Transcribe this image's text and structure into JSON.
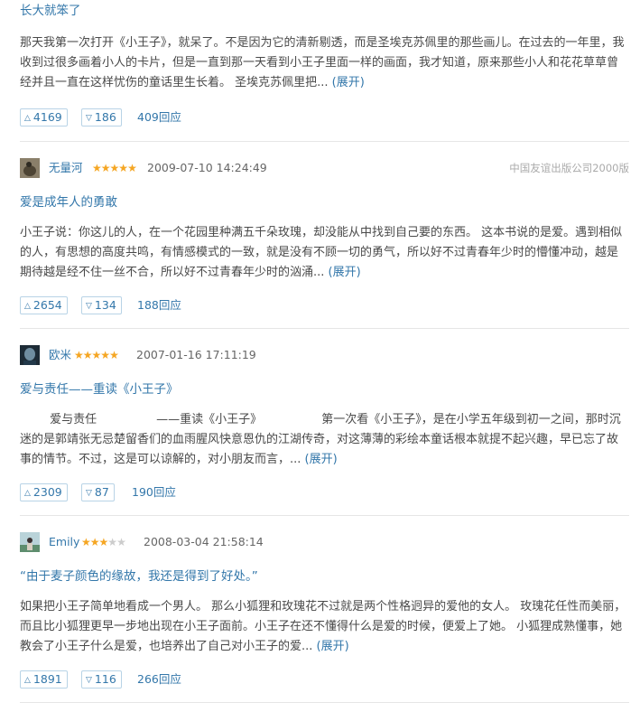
{
  "reviews": [
    {
      "title": "长大就笨了",
      "body": "那天我第一次打开《小王子》，就呆了。不是因为它的清新剔透，而是圣埃克苏佩里的那些画儿。在过去的一年里，我收到过很多画着小人的卡片，但是一直到那一天看到小王子里面一样的画面，我才知道，原来那些小人和花花草草曾经并且一直在这样忧伤的童话里生长着。 圣埃克苏佩里把... ",
      "expand": "(展开)",
      "useful": "4169",
      "useless": "186",
      "replies": "409回应"
    },
    {
      "author": "无量河",
      "rating": 5,
      "time": "2009-07-10 14:24:49",
      "source": "中国友谊出版公司2000版",
      "title": "爱是成年人的勇敢",
      "body": "小王子说：你这儿的人，在一个花园里种满五千朵玫瑰，却没能从中找到自己要的东西。 这本书说的是爱。遇到相似的人，有思想的高度共鸣，有情感模式的一致，就是没有不顾一切的勇气，所以好不过青春年少时的懵懂冲动，越是期待越是经不住一丝不合，所以好不过青春年少时的汹涌... ",
      "expand": "(展开)",
      "useful": "2654",
      "useless": "134",
      "replies": "188回应"
    },
    {
      "author": "欧米",
      "rating": 5,
      "time": "2007-01-16 17:11:19",
      "title": "爱与责任——重读《小王子》",
      "body": "        爱与责任                ——重读《小王子》                第一次看《小王子》，是在小学五年级到初一之间，那时沉迷的是郭靖张无忌楚留香们的血雨腥风快意恩仇的江湖传奇，对这薄薄的彩绘本童话根本就提不起兴趣，早已忘了故事的情节。不过，这是可以谅解的，对小朋友而言，... ",
      "expand": "(展开)",
      "useful": "2309",
      "useless": "87",
      "replies": "190回应"
    },
    {
      "author": "Emily",
      "rating": 3,
      "time": "2008-03-04 21:58:14",
      "title": "“由于麦子颜色的缘故，我还是得到了好处。”",
      "body": "如果把小王子简单地看成一个男人。 那么小狐狸和玫瑰花不过就是两个性格迥异的爱他的女人。 玫瑰花任性而美丽，而且比小狐狸更早一步地出现在小王子面前。小王子在还不懂得什么是爱的时候，便爱上了她。 小狐狸成熟懂事，她教会了小王子什么是爱，也培养出了自己对小王子的爱... ",
      "expand": "(展开)",
      "useful": "1891",
      "useless": "116",
      "replies": "266回应"
    }
  ],
  "icons": {
    "up": "up-triangle-icon",
    "down": "down-triangle-icon",
    "star": "star-icon"
  },
  "colors": {
    "link": "#3377aa",
    "star_on": "#f5a623",
    "star_off": "#cccccc",
    "text": "#494949"
  }
}
